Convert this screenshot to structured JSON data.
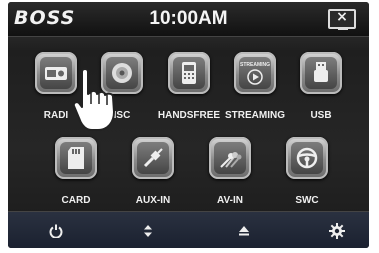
{
  "header": {
    "brand": "BOSS",
    "time": "10:00AM",
    "close_icon": "screen-close-icon"
  },
  "menu": {
    "row1": [
      {
        "label": "RADI",
        "icon": "radio-icon"
      },
      {
        "label": "ISC",
        "icon": "disc-icon"
      },
      {
        "label": "HANDSFREE",
        "icon": "phone-icon"
      },
      {
        "label": "STREAMING",
        "icon": "streaming-play-icon",
        "icon_text": "STREAMING"
      },
      {
        "label": "USB",
        "icon": "usb-icon"
      }
    ],
    "row2": [
      {
        "label": "CARD",
        "icon": "sd-card-icon"
      },
      {
        "label": "AUX-IN",
        "icon": "aux-cable-icon"
      },
      {
        "label": "AV-IN",
        "icon": "av-cables-icon"
      },
      {
        "label": "SWC",
        "icon": "steering-wheel-icon"
      }
    ]
  },
  "bottombar": {
    "icons": [
      "power-icon",
      "up-down-icon",
      "eject-icon",
      "settings-gear-icon"
    ]
  },
  "colors": {
    "background": "#222222",
    "text": "#f0f0f0",
    "bottombar": "#1f2533"
  }
}
